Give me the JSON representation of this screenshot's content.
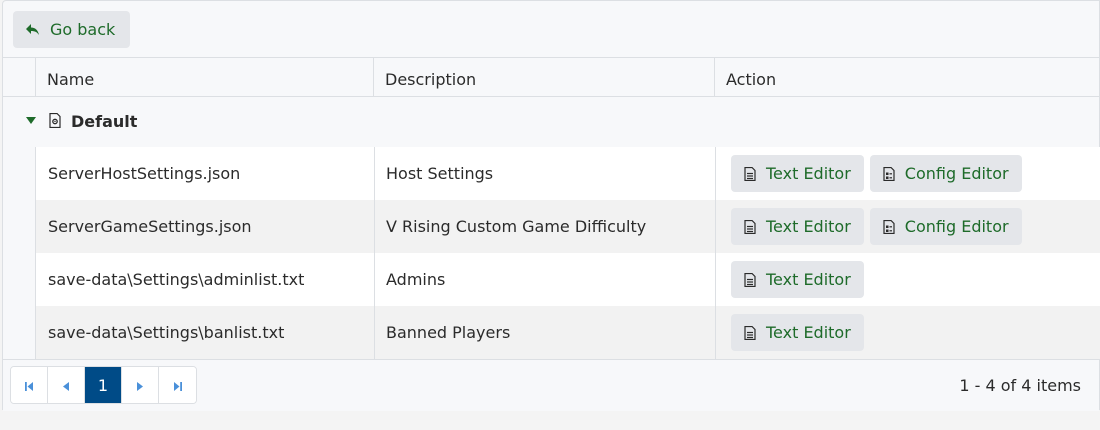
{
  "toolbar": {
    "back_label": "Go back"
  },
  "columns": {
    "name": "Name",
    "description": "Description",
    "action": "Action"
  },
  "group": {
    "label": "Default"
  },
  "rows": [
    {
      "name": "ServerHostSettings.json",
      "description": "Host Settings",
      "text_editor": "Text Editor",
      "config_editor": "Config Editor"
    },
    {
      "name": "ServerGameSettings.json",
      "description": "V Rising Custom Game Difficulty",
      "text_editor": "Text Editor",
      "config_editor": "Config Editor"
    },
    {
      "name": "save-data\\Settings\\adminlist.txt",
      "description": "Admins",
      "text_editor": "Text Editor"
    },
    {
      "name": "save-data\\Settings\\banlist.txt",
      "description": "Banned Players",
      "text_editor": "Text Editor"
    }
  ],
  "pager": {
    "current_page": "1",
    "info": "1 - 4 of 4 items"
  },
  "colors": {
    "accent_green": "#1e6b2a",
    "pager_active": "#004b87"
  }
}
